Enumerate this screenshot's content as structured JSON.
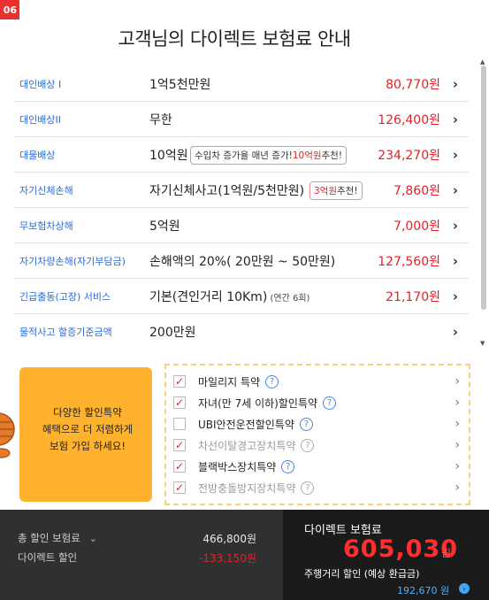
{
  "header": {
    "step_badge": "06",
    "title": "고객님의 다이렉트 보험료 안내"
  },
  "coverages": [
    {
      "label": "대인배상 I",
      "value": "1억5천만원",
      "price": "80,770원"
    },
    {
      "label": "대인배상II",
      "value": "무한",
      "price": "126,400원"
    },
    {
      "label": "대물배상",
      "value": "10억원",
      "price": "234,270원"
    },
    {
      "label": "자기신체손해",
      "value": "자기신체사고(1억원/5천만원)",
      "price": "7,860원"
    },
    {
      "label": "무보험차상해",
      "value": "5억원",
      "price": "7,000원"
    },
    {
      "label": "자기차량손해(자기부담금)",
      "value": "손해액의 20%( 20만원 ~ 50만원)",
      "price": "127,560원"
    },
    {
      "label": "긴급출동(고장) 서비스",
      "value": "기본(견인거리 10Km)",
      "value_small": " (연간 6회)",
      "price": "21,170원"
    },
    {
      "label": "물적사고 할증기준금액",
      "value": "200만원",
      "price": ""
    }
  ],
  "tooltips": {
    "property": {
      "prefix": "수입차 증가율 매년 증가! ",
      "highlight": "10억원",
      "suffix": " 추천!"
    },
    "bodily": {
      "highlight": "3억원",
      "suffix": " 추천!"
    }
  },
  "promo": {
    "line1": "다양한 할인특약",
    "line2": "혜택으로 더 저렴하게",
    "line3": "보험 가입 하세요!"
  },
  "discounts": [
    {
      "label": "마일리지 특약",
      "checked": true,
      "enabled": true
    },
    {
      "label": "자녀(만 7세 이하)할인특약",
      "checked": true,
      "enabled": true
    },
    {
      "label": "UBI안전운전할인특약",
      "checked": false,
      "enabled": true
    },
    {
      "label": "차선이탈경고장치특약",
      "checked": true,
      "enabled": false
    },
    {
      "label": "블랙박스장치특약",
      "checked": true,
      "enabled": true
    },
    {
      "label": "전방충돌방지장치특약",
      "checked": true,
      "enabled": false
    }
  ],
  "footer": {
    "total_label": "총 할인 보험료",
    "total_value": "466,800원",
    "direct_discount_label": "다이렉트 할인",
    "direct_discount_value": "-133,150원",
    "premium_title": "다이렉트 보험료",
    "premium_value": "605,030",
    "premium_unit": "원",
    "mileage_label": "주행거리 할인 (예상 환급금)",
    "mileage_value": "192,670 원"
  },
  "colors": {
    "accent_red": "#e0242a",
    "label_blue": "#2a6ad6",
    "promo_yellow": "#ffb22e",
    "footer_dark": "#303030"
  },
  "icons": {
    "chevron": "›",
    "help": "?",
    "check": "✓",
    "total_dropdown": "⌄"
  }
}
